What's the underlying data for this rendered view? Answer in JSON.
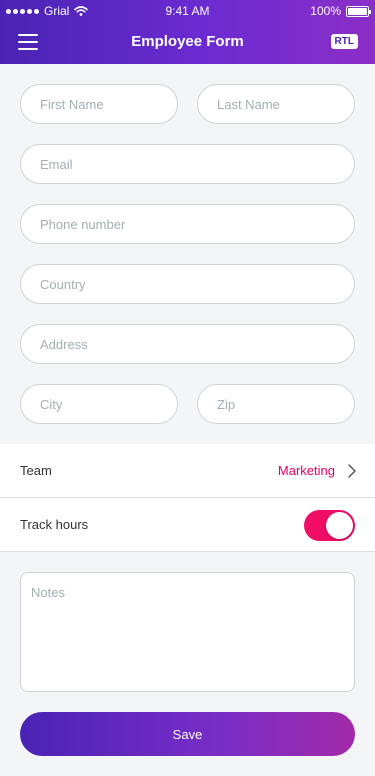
{
  "status_bar": {
    "carrier": "Grial",
    "time": "9:41 AM",
    "battery": "100%",
    "battery_level": 1.0
  },
  "header": {
    "title": "Employee Form",
    "rtl_label": "RTL",
    "menu_icon": "hamburger-menu-icon"
  },
  "form": {
    "first_name": {
      "placeholder": "First Name",
      "value": ""
    },
    "last_name": {
      "placeholder": "Last Name",
      "value": ""
    },
    "email": {
      "placeholder": "Email",
      "value": ""
    },
    "phone": {
      "placeholder": "Phone number",
      "value": ""
    },
    "country": {
      "placeholder": "Country",
      "value": ""
    },
    "address": {
      "placeholder": "Address",
      "value": ""
    },
    "city": {
      "placeholder": "City",
      "value": ""
    },
    "zip": {
      "placeholder": "Zip",
      "value": ""
    }
  },
  "team": {
    "label": "Team",
    "value": "Marketing"
  },
  "track_hours": {
    "label": "Track hours",
    "enabled": true
  },
  "notes": {
    "placeholder": "Notes",
    "value": ""
  },
  "save_label": "Save",
  "colors": {
    "primary": "#4a23b4",
    "accent": "#ef0d66",
    "team_value": "#e5006a"
  }
}
